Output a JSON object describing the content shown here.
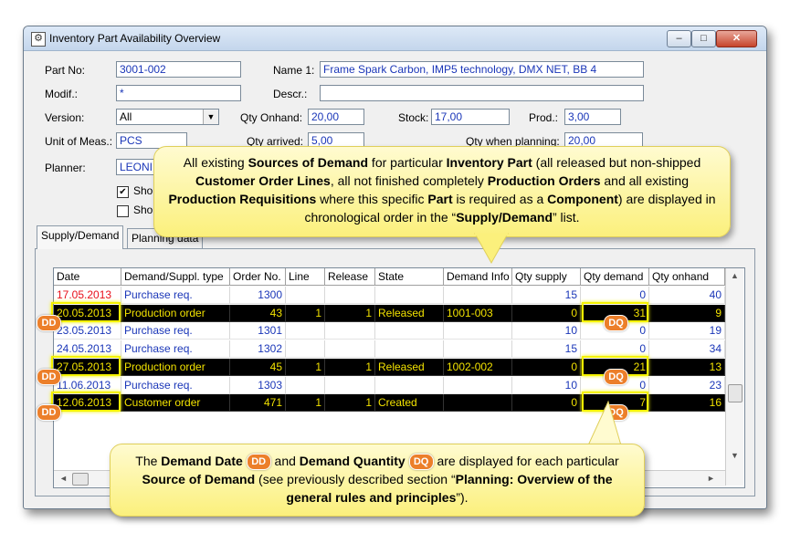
{
  "window": {
    "title": "Inventory Part Availability Overview",
    "min_glyph": "–",
    "max_glyph": "□",
    "close_glyph": "✕"
  },
  "form": {
    "part_no_label": "Part No:",
    "part_no_value": "3001-002",
    "name1_label": "Name 1:",
    "name1_value": "Frame Spark Carbon, IMP5 technology, DMX NET, BB 4",
    "modif_label": "Modif.:",
    "modif_value": "*",
    "descr_label": "Descr.:",
    "descr_value": "",
    "version_label": "Version:",
    "version_value": "All",
    "qty_onhand_label": "Qty Onhand:",
    "qty_onhand_value": "20,00",
    "stock_label": "Stock:",
    "stock_value": "17,00",
    "prod_label": "Prod.:",
    "prod_value": "3,00",
    "uom_label": "Unit of Meas.:",
    "uom_value": "PCS",
    "qty_arrived_label": "Qty arrived:",
    "qty_arrived_value": "5,00",
    "qty_planning_label": "Qty when planning:",
    "qty_planning_value": "20,00",
    "planner_label": "Planner:",
    "planner_value": "LEONI",
    "show1_label": "Sho",
    "show2_label": "Sho",
    "check_glyph": "✔"
  },
  "tabs": {
    "supply_demand": "Supply/Demand",
    "planning_data": "Planning data"
  },
  "table": {
    "headers": [
      "Date",
      "Demand/Suppl. type",
      "Order No.",
      "Line",
      "Release",
      "State",
      "Demand Info",
      "Qty supply",
      "Qty demand",
      "Qty onhand"
    ],
    "rows": [
      {
        "date": "17.05.2013",
        "type": "Purchase req.",
        "order": "1300",
        "line": "",
        "release": "",
        "state": "",
        "info": "",
        "supply": "15",
        "demand": "0",
        "onhand": "40",
        "style": "normal",
        "date_color": "#e8101a"
      },
      {
        "date": "20.05.2013",
        "type": "Production order",
        "order": "43",
        "line": "1",
        "release": "1",
        "state": "Released",
        "info": "1001-003",
        "supply": "0",
        "demand": "31",
        "onhand": "9",
        "style": "highlight",
        "date_color": "#f2e200"
      },
      {
        "date": "23.05.2013",
        "type": "Purchase req.",
        "order": "1301",
        "line": "",
        "release": "",
        "state": "",
        "info": "",
        "supply": "10",
        "demand": "0",
        "onhand": "19",
        "style": "normal",
        "date_color": "#1a36b8"
      },
      {
        "date": "24.05.2013",
        "type": "Purchase req.",
        "order": "1302",
        "line": "",
        "release": "",
        "state": "",
        "info": "",
        "supply": "15",
        "demand": "0",
        "onhand": "34",
        "style": "normal",
        "date_color": "#1a36b8"
      },
      {
        "date": "27.05.2013",
        "type": "Production order",
        "order": "45",
        "line": "1",
        "release": "1",
        "state": "Released",
        "info": "1002-002",
        "supply": "0",
        "demand": "21",
        "onhand": "13",
        "style": "highlight",
        "date_color": "#f2e200"
      },
      {
        "date": "11.06.2013",
        "type": "Purchase req.",
        "order": "1303",
        "line": "",
        "release": "",
        "state": "",
        "info": "",
        "supply": "10",
        "demand": "0",
        "onhand": "23",
        "style": "normal",
        "date_color": "#1a36b8"
      },
      {
        "date": "12.06.2013",
        "type": "Customer order",
        "order": "471",
        "line": "1",
        "release": "1",
        "state": "Created",
        "info": "",
        "supply": "0",
        "demand": "7",
        "onhand": "16",
        "style": "highlight",
        "date_color": "#f2e200"
      }
    ]
  },
  "badges": {
    "dd": "DD",
    "dq": "DQ"
  },
  "callout_top": {
    "t1": "All existing ",
    "b1": "Sources of Demand",
    "t2": " for particular ",
    "b2": "Inventory Part",
    "t3": " (all released but non-shipped ",
    "b3": "Customer Order Lines",
    "t4": ", all not finished completely ",
    "b4": "Production  Orders",
    "t5": " and all existing ",
    "b5": "Production  Requisitions",
    "t6": " where this specific ",
    "b6": "Part",
    "t7": " is required as a ",
    "b7": "Component",
    "t8": ") are displayed in chronological order in the “",
    "b8": "Supply/Demand",
    "t9": "” list."
  },
  "callout_bottom": {
    "t1": "The ",
    "b1": "Demand Date",
    "t2": " and ",
    "b2": "Demand Quantity",
    "t3": " are displayed for each particular ",
    "b3": "Source of Demand",
    "t4": " (see previously described section “",
    "b4": "Planning: Overview of the general rules and principles",
    "t5": "”)."
  }
}
